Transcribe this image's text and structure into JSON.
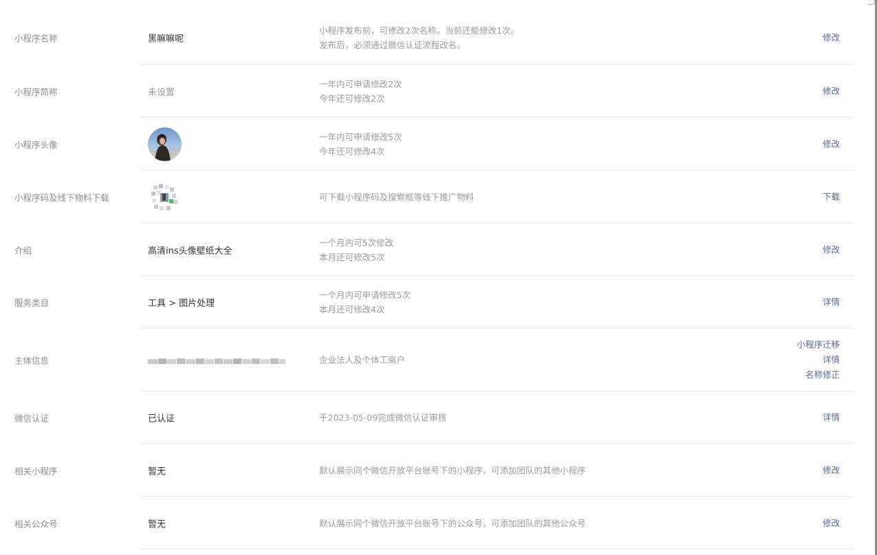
{
  "rows": [
    {
      "label": "小程序名称",
      "value": "黑嘛嘛呢",
      "desc": [
        "小程序发布前，可修改2次名称。当前还能修改1次。",
        "发布后，必须通过微信认证流程改名。"
      ],
      "actions": [
        "修改"
      ]
    },
    {
      "label": "小程序简称",
      "value": "未设置",
      "desc": [
        "一年内可申请修改2次",
        "今年还可修改2次"
      ],
      "actions": [
        "修改"
      ]
    },
    {
      "label": "小程序头像",
      "value_icon": "avatar-image",
      "desc": [
        "一年内可申请修改5次",
        "今年还可修改4次"
      ],
      "actions": [
        "修改"
      ]
    },
    {
      "label": "小程序码及线下物料下载",
      "value_icon": "mini-program-code-image",
      "desc": [
        "可下载小程序码及搜索框等线下推广物料"
      ],
      "actions": [
        "下载"
      ]
    },
    {
      "label": "介绍",
      "value": "高清ins头像壁纸大全",
      "desc": [
        "一个月内可5次修改",
        "本月还可修改5次"
      ],
      "actions": [
        "修改"
      ]
    },
    {
      "label": "服务类目",
      "value": "工具 > 图片处理",
      "desc": [
        "一个月内可申请修改5次",
        "本月还可修改4次"
      ],
      "actions": [
        "详情"
      ]
    },
    {
      "label": "主体信息",
      "value_icon": "blurred-entity-name",
      "desc": [
        "企业法人及个体工商户"
      ],
      "actions": [
        "小程序迁移",
        "详情",
        "名称修正"
      ]
    },
    {
      "label": "微信认证",
      "value": "已认证",
      "desc": [
        "于2023-05-09完成微信认证审核"
      ],
      "actions": [
        "详情"
      ]
    },
    {
      "label": "相关小程序",
      "value": "暂无",
      "desc": [
        "默认展示同个微信开放平台账号下的小程序，可添加团队的其他小程序"
      ],
      "actions": [
        "修改"
      ]
    },
    {
      "label": "相关公众号",
      "value": "暂无",
      "desc": [
        "默认展示同个微信开放平台账号下的公众号，可添加团队的其他公众号"
      ],
      "actions": [
        "修改"
      ]
    }
  ],
  "colors": {
    "link": "#576b95",
    "label": "#8f8f8f",
    "value": "#353535",
    "desc": "#9c9c9c",
    "divider": "#e7e7e7"
  }
}
